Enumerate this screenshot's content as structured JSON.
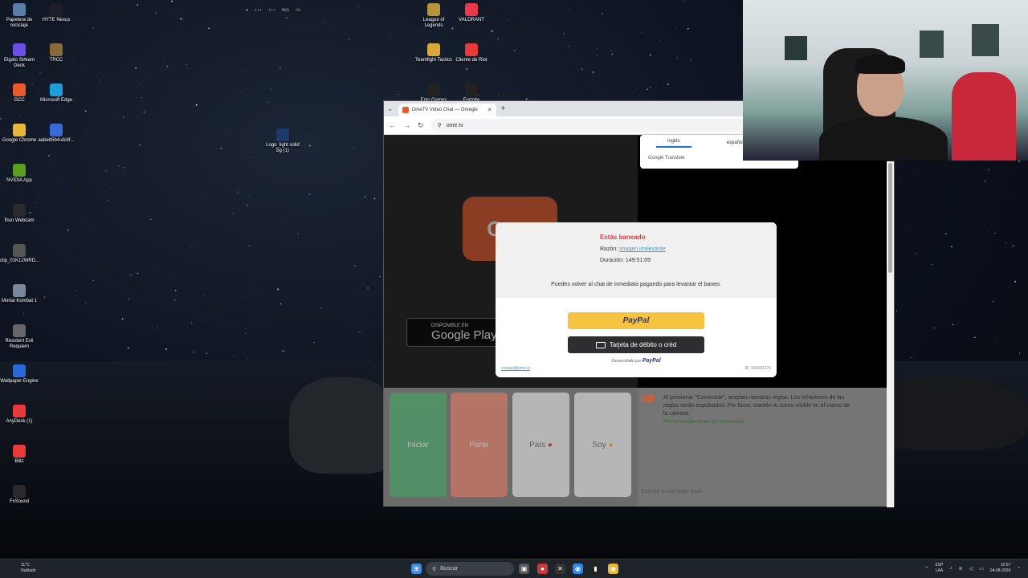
{
  "desktop": {
    "icons": [
      {
        "label": "Papelera de reciclaje",
        "icon": "recycle-bin-icon",
        "color": "#5a7ea8"
      },
      {
        "label": "HYTE Nexus",
        "icon": "hyte-nexus-icon",
        "color": "#1e1e2a"
      },
      {
        "label": "Elgato Stream Deck",
        "icon": "stream-deck-icon",
        "color": "#6a4ee8"
      },
      {
        "label": "TRCC",
        "icon": "trcc-icon",
        "color": "#8a6a3a"
      },
      {
        "label": "GCC",
        "icon": "gcc-icon",
        "color": "#e85a2a"
      },
      {
        "label": "Microsoft Edge",
        "icon": "edge-icon",
        "color": "#1e9ed8"
      },
      {
        "label": "Google Chrome",
        "icon": "chrome-icon",
        "color": "#e8b83a"
      },
      {
        "label": "aabeb5b4-dc6f...",
        "icon": "file-icon",
        "color": "#3a6ad8"
      },
      {
        "label": "NVIDIA App",
        "icon": "nvidia-icon",
        "color": "#5a9e1e"
      },
      {
        "label": "Iriun Webcam",
        "icon": "webcam-icon",
        "color": "#2a2a2a"
      },
      {
        "label": "clip_01K12WRD...",
        "icon": "video-clip-icon",
        "color": "#555555"
      },
      {
        "label": "Mortal Kombat 1",
        "icon": "mortal-kombat-icon",
        "color": "#7a8a9a"
      },
      {
        "label": "Resident Evil Requiem",
        "icon": "resident-evil-icon",
        "color": "#666666"
      },
      {
        "label": "Wallpaper Engine",
        "icon": "wallpaper-engine-icon",
        "color": "#2a6ad8"
      },
      {
        "label": "AnyDesk (1)",
        "icon": "anydesk-icon",
        "color": "#e83a3a"
      },
      {
        "label": "Blitz",
        "icon": "blitz-icon",
        "color": "#e83a3a"
      },
      {
        "label": "FxSound",
        "icon": "fxsound-icon",
        "color": "#2a2a2a"
      },
      {
        "label": "Logo_light solid bg (1)",
        "icon": "image-file-icon",
        "color": "#1e3a6a"
      },
      {
        "label": "League of Legends",
        "icon": "league-icon",
        "color": "#b8943a"
      },
      {
        "label": "VALORANT",
        "icon": "valorant-icon",
        "color": "#e83a4a"
      },
      {
        "label": "Teamfight Tactics",
        "icon": "tft-icon",
        "color": "#d8a83a"
      },
      {
        "label": "Cliente de Riot",
        "icon": "riot-client-icon",
        "color": "#e83a3a"
      },
      {
        "label": "Epic Games",
        "icon": "epic-games-icon",
        "color": "#222222"
      },
      {
        "label": "Fortnite",
        "icon": "fortnite-icon",
        "color": "#222222"
      }
    ],
    "overlay": {
      "items": [
        "●",
        "•••",
        "•••",
        "MSS"
      ],
      "status": "ON"
    }
  },
  "browser": {
    "tab_title": "OmeTV Video Chat — Omegle",
    "url": "ome.tv",
    "brand_color": "#e8592b",
    "logo_text": "Ome",
    "google_play": {
      "small": "DISPONIBLE EN",
      "big": "Google Play"
    },
    "controls": {
      "start": {
        "label": "Iniciar",
        "color": "#3fae62"
      },
      "stop": {
        "label": "Parar",
        "color": "#f27b63"
      },
      "country": {
        "label": "País",
        "color": "#f4f4f4"
      },
      "gender": {
        "label": "Soy",
        "color": "#f4f4f4"
      }
    },
    "chat": {
      "message": "Al presionar \"Comenzar\", aceptas nuestras reglas. Los infractores de las reglas serán expulsados. Por favor, mantén tu rostro visible en el marco de la cámara.",
      "safety_link": "Recomendaciones de seguridad",
      "input_placeholder": "Escribe tu mensaje aquí"
    }
  },
  "translate": {
    "tabs": [
      "inglés",
      "español"
    ],
    "footer": "Google Translate"
  },
  "modal": {
    "title": "Estás baneado",
    "reason_label": "Razón:",
    "reason_value": "imagen irrelevante",
    "duration_label": "Duración:",
    "duration_value": "149:51:09",
    "note": "Puedes volver al chat de inmediato pagando para levantar el baneo.",
    "paypal_label": "PayPal",
    "card_label": "Tarjeta de débito o créd",
    "powered_prefix": "Desarrollado por",
    "powered_brand": "PayPal",
    "contact": "contact@ome.tv",
    "id_text": "ID: 335692276",
    "paypal_color": "#f5c340",
    "title_color": "#d94040"
  },
  "taskbar": {
    "weather_temp": "11°C",
    "weather_desc": "Nublado",
    "search_placeholder": "Buscar",
    "lang_top": "ESP",
    "lang_bottom": "LAA",
    "time": "22:57",
    "date": "04-08-2026"
  }
}
